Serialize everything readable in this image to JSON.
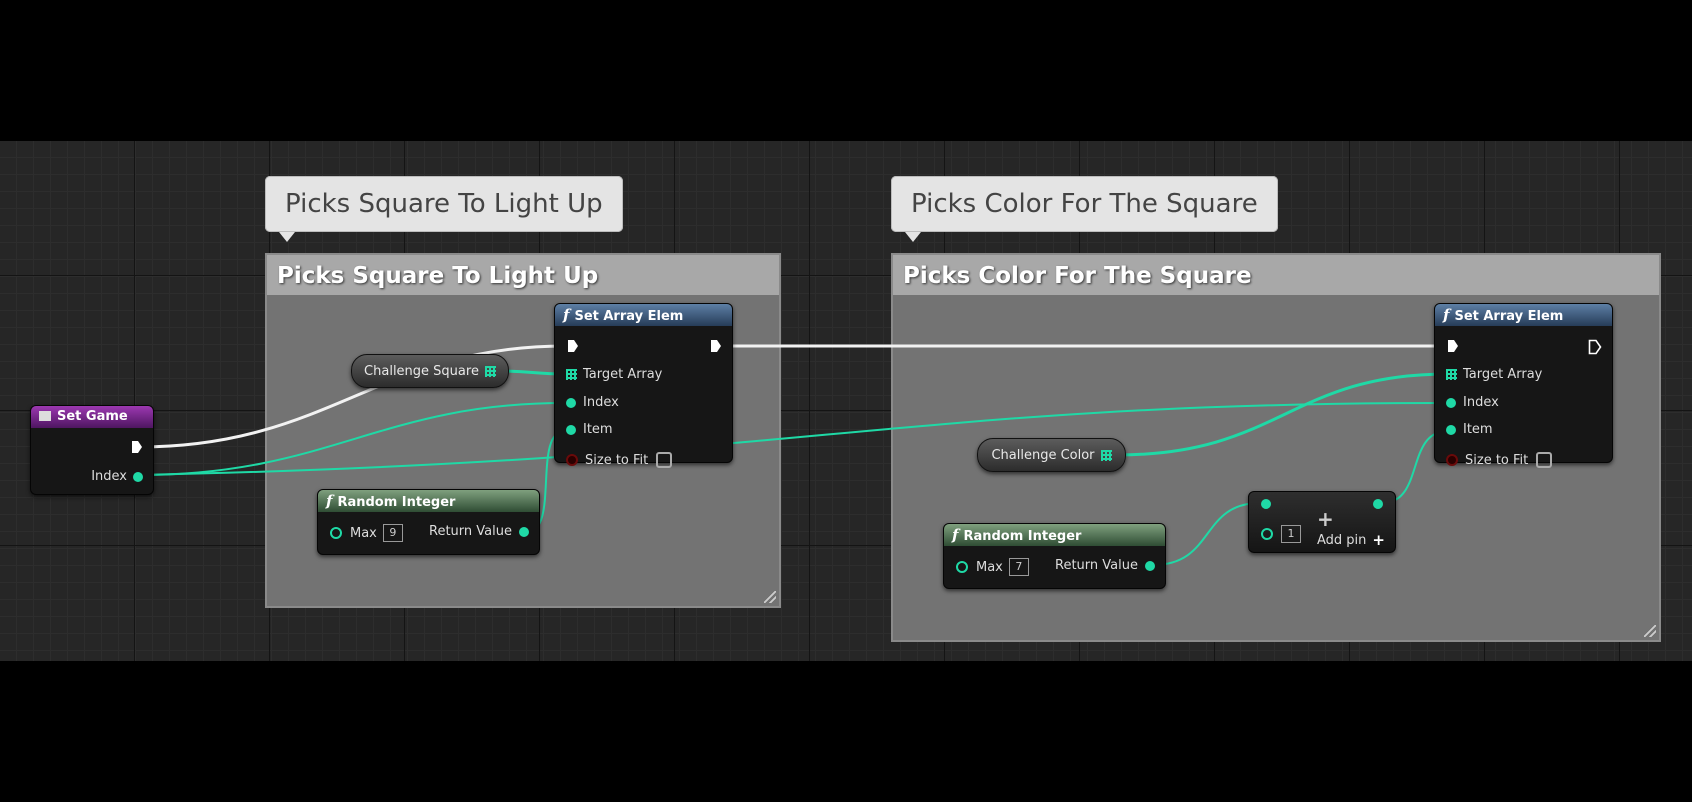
{
  "comments": [
    {
      "bubble": "Picks Square To Light Up",
      "title": "Picks Square To Light Up"
    },
    {
      "bubble": "Picks Color For The Square",
      "title": "Picks Color For The Square"
    }
  ],
  "set_game": {
    "title": "Set Game",
    "index_label": "Index"
  },
  "variables": {
    "challenge_square": "Challenge Square",
    "challenge_color": "Challenge Color"
  },
  "set_array_elem": {
    "title": "Set Array Elem",
    "target_array": "Target Array",
    "index": "Index",
    "item": "Item",
    "size_to_fit": "Size to Fit"
  },
  "random_integer_1": {
    "title": "Random Integer",
    "max_label": "Max",
    "max_value": "9",
    "return_value": "Return Value"
  },
  "random_integer_2": {
    "title": "Random Integer",
    "max_label": "Max",
    "max_value": "7",
    "return_value": "Return Value"
  },
  "add_node": {
    "value": "1",
    "add_pin": "Add pin",
    "symbol": "+"
  },
  "colors": {
    "exec_wire": "#f2f2f2",
    "int_wire": "#1fd9a6",
    "function_header": "#2f4a6e",
    "pure_header": "#3d6a3f",
    "event_header": "#7a1f92"
  }
}
